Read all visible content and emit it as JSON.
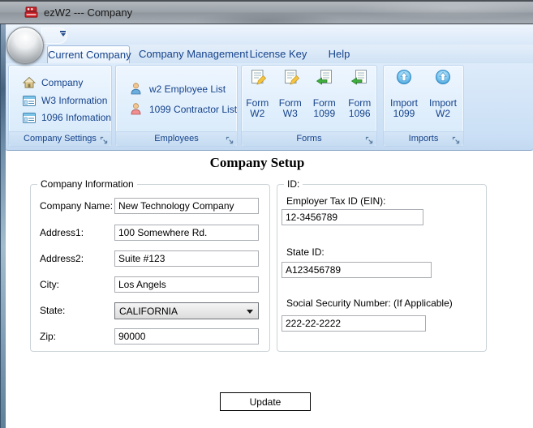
{
  "window": {
    "title": "ezW2 --- Company"
  },
  "tabs": {
    "items": [
      {
        "label": "Current Company",
        "selected": true
      },
      {
        "label": "Company Management",
        "selected": false
      },
      {
        "label": "License Key",
        "selected": false
      },
      {
        "label": "Help",
        "selected": false
      }
    ]
  },
  "ribbon": {
    "groups": [
      {
        "label": "Company Settings",
        "items": [
          {
            "icon": "house-icon",
            "label": "Company"
          },
          {
            "icon": "form-window-icon",
            "label": "W3 Information"
          },
          {
            "icon": "form-window-icon",
            "label": "1096 Infomation"
          }
        ]
      },
      {
        "label": "Employees",
        "items": [
          {
            "icon": "person-blue-icon",
            "label": "w2 Employee List"
          },
          {
            "icon": "person-red-icon",
            "label": "1099 Contractor List"
          }
        ]
      },
      {
        "label": "Forms",
        "items": [
          {
            "icon": "document-pencil-icon",
            "line1": "Form",
            "line2": "W2"
          },
          {
            "icon": "document-pencil-icon",
            "line1": "Form",
            "line2": "W3"
          },
          {
            "icon": "document-green-arrow-icon",
            "line1": "Form",
            "line2": "1099"
          },
          {
            "icon": "document-green-arrow-icon",
            "line1": "Form",
            "line2": "1096"
          }
        ]
      },
      {
        "label": "Imports",
        "items": [
          {
            "icon": "import-up-arrow-icon",
            "line1": "Import",
            "line2": "1099"
          },
          {
            "icon": "import-up-arrow-icon",
            "line1": "Import",
            "line2": "W2"
          }
        ]
      }
    ]
  },
  "main": {
    "heading": "Company Setup",
    "company_info": {
      "legend": "Company Information",
      "fields": [
        {
          "label": "Company Name:",
          "value": "New Technology Company"
        },
        {
          "label": "Address1:",
          "value": "100 Somewhere Rd."
        },
        {
          "label": "Address2:",
          "value": "Suite #123"
        },
        {
          "label": "City:",
          "value": "Los Angels"
        },
        {
          "label": "State:",
          "value": "CALIFORNIA"
        },
        {
          "label": "Zip:",
          "value": "90000"
        }
      ]
    },
    "ids": {
      "legend": "ID:",
      "fields": [
        {
          "label": "Employer Tax ID (EIN):",
          "value": "12-3456789"
        },
        {
          "label": "State ID:",
          "value": "A123456789"
        },
        {
          "label": "Social Security Number: (If Applicable)",
          "value": "222-22-2222"
        }
      ]
    },
    "update_button": "Update"
  },
  "colors": {
    "ribbon_text": "#15428b",
    "app_icon_red": "#cc2127",
    "selected_tab_border": "#9ab6dc",
    "ribbon_background": "#d8e8f8",
    "titlebar_gray": "#9aa1a8"
  }
}
